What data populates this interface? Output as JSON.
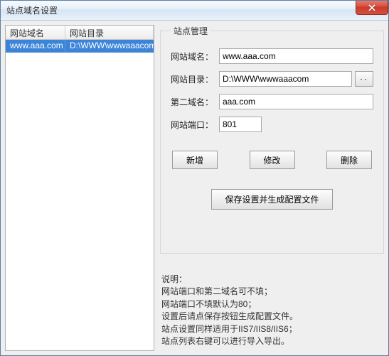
{
  "window": {
    "title": "站点域名设置"
  },
  "table": {
    "headers": {
      "domain": "网站域名",
      "dir": "网站目录"
    },
    "rows": [
      {
        "domain": "www.aaa.com",
        "dir": "D:\\WWW\\wwwaaacom"
      }
    ]
  },
  "group": {
    "title": "站点管理",
    "fields": {
      "domain_label": "网站域名：",
      "domain_value": "www.aaa.com",
      "dir_label": "网站目录：",
      "dir_value": "D:\\WWW\\wwwaaacom",
      "browse_label": "··",
      "second_label": "第二域名：",
      "second_value": "aaa.com",
      "port_label": "网站端口：",
      "port_value": "801"
    },
    "buttons": {
      "add": "新增",
      "edit": "修改",
      "delete": "删除",
      "save": "保存设置并生成配置文件"
    }
  },
  "help": {
    "title": "说明：",
    "line1": "网站端口和第二域名可不填；",
    "line2": "网站端口不填默认为80；",
    "line3": "设置后请点保存按钮生成配置文件。",
    "line4": "站点设置同样适用于IIS7/IIS8/IIS6；",
    "line5": "站点列表右键可以进行导入导出。"
  }
}
